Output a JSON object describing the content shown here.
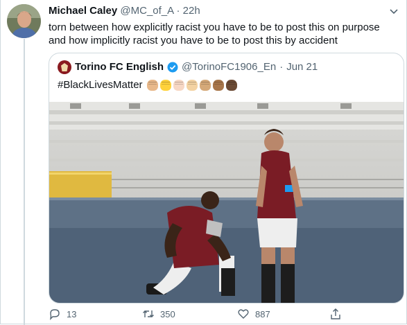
{
  "tweet": {
    "author_name": "Michael Caley",
    "author_handle": "@MC_of_A",
    "separator": "·",
    "time": "22h",
    "text_line1": "torn between how explicitly racist you have to be to post this on purpose",
    "text_line2": "and how implicitly racist you have to be to post this by accident"
  },
  "quoted_tweet": {
    "author_name": "Torino FC English",
    "author_handle": "@TorinoFC1906_En",
    "separator": "·",
    "date": "Jun 21",
    "hashtag": "#BlackLivesMatter",
    "fist_colors": [
      "#e8b88a",
      "#ffd23b",
      "#f7d7c4",
      "#f3d2a2",
      "#d5a979",
      "#a8764a",
      "#6b4a34"
    ]
  },
  "actions": {
    "reply_count": "13",
    "retweet_count": "350",
    "like_count": "887"
  },
  "colors": {
    "accent": "#1d9bf0",
    "text": "#0f1419",
    "muted": "#536471",
    "border": "#cfd9de"
  }
}
